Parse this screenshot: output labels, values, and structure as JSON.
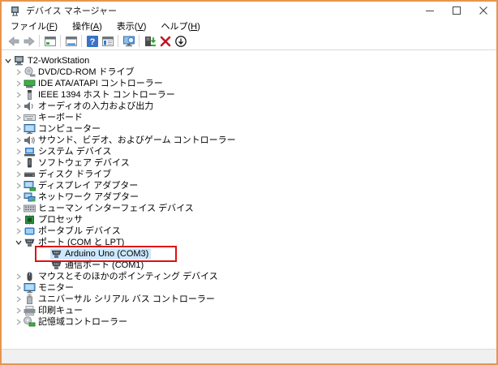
{
  "window": {
    "title": "デバイス マネージャー",
    "app_icon": "device-manager",
    "controls": [
      {
        "name": "minimize",
        "icon": "minimize"
      },
      {
        "name": "maximize",
        "icon": "maximize"
      },
      {
        "name": "close",
        "icon": "close"
      }
    ]
  },
  "menubar": {
    "items": [
      {
        "name": "file",
        "label": "ファイル",
        "mnemonic": "F"
      },
      {
        "name": "action",
        "label": "操作",
        "mnemonic": "A"
      },
      {
        "name": "view",
        "label": "表示",
        "mnemonic": "V"
      },
      {
        "name": "help",
        "label": "ヘルプ",
        "mnemonic": "H"
      }
    ]
  },
  "toolbar": {
    "buttons": [
      {
        "name": "back",
        "icon": "back-arrow",
        "enabled": false
      },
      {
        "name": "forward",
        "icon": "forward-arrow",
        "enabled": false
      },
      {
        "sep": true
      },
      {
        "name": "show-console-tree",
        "icon": "console-window"
      },
      {
        "sep": true
      },
      {
        "name": "properties",
        "icon": "properties-window"
      },
      {
        "sep": true
      },
      {
        "name": "help",
        "icon": "help"
      },
      {
        "name": "action-pane",
        "icon": "list-window"
      },
      {
        "sep": true
      },
      {
        "name": "scan-hardware-changes",
        "icon": "scan-hardware"
      },
      {
        "sep": true
      },
      {
        "name": "update-driver",
        "icon": "update-driver"
      },
      {
        "name": "uninstall-device",
        "icon": "uninstall"
      },
      {
        "name": "disable-device",
        "icon": "disable"
      }
    ]
  },
  "tree": {
    "rows": [
      {
        "level": 0,
        "chevron": "expanded",
        "icon": "workstation",
        "label": "T2-WorkStation"
      },
      {
        "level": 1,
        "chevron": "collapsed",
        "icon": "cd-drive",
        "label": "DVD/CD-ROM ドライブ"
      },
      {
        "level": 1,
        "chevron": "collapsed",
        "icon": "ide-controller",
        "label": "IDE ATA/ATAPI コントローラー"
      },
      {
        "level": 1,
        "chevron": "collapsed",
        "icon": "ieee1394",
        "label": "IEEE 1394 ホスト コントローラー"
      },
      {
        "level": 1,
        "chevron": "collapsed",
        "icon": "audio-io",
        "label": "オーディオの入力および出力"
      },
      {
        "level": 1,
        "chevron": "collapsed",
        "icon": "keyboard",
        "label": "キーボード"
      },
      {
        "level": 1,
        "chevron": "collapsed",
        "icon": "computer",
        "label": "コンピューター"
      },
      {
        "level": 1,
        "chevron": "collapsed",
        "icon": "sound",
        "label": "サウンド、ビデオ、およびゲーム コントローラー"
      },
      {
        "level": 1,
        "chevron": "collapsed",
        "icon": "system-device",
        "label": "システム デバイス"
      },
      {
        "level": 1,
        "chevron": "collapsed",
        "icon": "software-device",
        "label": "ソフトウェア デバイス"
      },
      {
        "level": 1,
        "chevron": "collapsed",
        "icon": "disk-drive",
        "label": "ディスク ドライブ"
      },
      {
        "level": 1,
        "chevron": "collapsed",
        "icon": "display-adapter",
        "label": "ディスプレイ アダプター"
      },
      {
        "level": 1,
        "chevron": "collapsed",
        "icon": "network-adapter",
        "label": "ネットワーク アダプター"
      },
      {
        "level": 1,
        "chevron": "collapsed",
        "icon": "hid",
        "label": "ヒューマン インターフェイス デバイス"
      },
      {
        "level": 1,
        "chevron": "collapsed",
        "icon": "processor",
        "label": "プロセッサ"
      },
      {
        "level": 1,
        "chevron": "collapsed",
        "icon": "portable-device",
        "label": "ポータブル デバイス"
      },
      {
        "level": 1,
        "chevron": "expanded",
        "icon": "port",
        "label": "ポート (COM と LPT)"
      },
      {
        "level": 2,
        "chevron": "none",
        "icon": "port",
        "label": "Arduino Uno (COM3)",
        "selected": true,
        "annotated": true
      },
      {
        "level": 2,
        "chevron": "none",
        "icon": "port",
        "label": "通信ポート (COM1)"
      },
      {
        "level": 1,
        "chevron": "collapsed",
        "icon": "mouse",
        "label": "マウスとそのほかのポインティング デバイス"
      },
      {
        "level": 1,
        "chevron": "collapsed",
        "icon": "monitor",
        "label": "モニター"
      },
      {
        "level": 1,
        "chevron": "collapsed",
        "icon": "usb",
        "label": "ユニバーサル シリアル バス コントローラー"
      },
      {
        "level": 1,
        "chevron": "collapsed",
        "icon": "printer",
        "label": "印刷キュー"
      },
      {
        "level": 1,
        "chevron": "collapsed",
        "icon": "storage-controller",
        "label": "記憶域コントローラー"
      }
    ]
  },
  "annotation": {
    "type": "red-box",
    "color": "#df1010",
    "target_label": "Arduino Uno (COM3)"
  },
  "selection": {
    "color": "#cce8ff",
    "selected_label": "Arduino Uno (COM3)"
  },
  "statusbar": {
    "text": ""
  }
}
